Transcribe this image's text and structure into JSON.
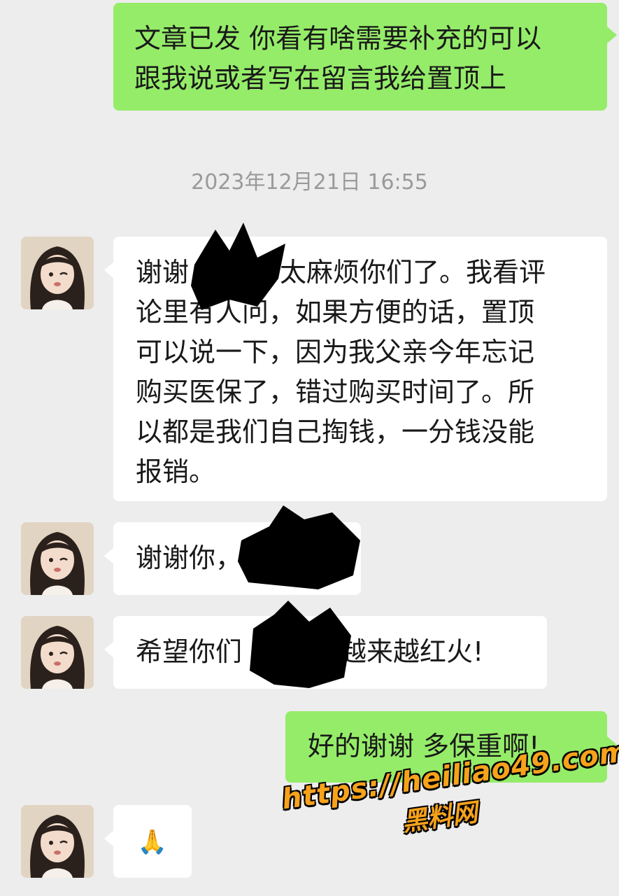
{
  "chat": {
    "messages": [
      {
        "side": "right",
        "lines": [
          "文章已发 你看有啥需要补充的可以",
          "跟我说或者写在留言我给置顶上"
        ]
      },
      {
        "side": "left",
        "lines": [
          "谢谢",
          "太麻烦你们了。我看评",
          "论里有人问，如果方便的话，置顶",
          "可以说一下，因为我父亲今年忘记",
          "购买医保了，错过购买时间了。所",
          "以都是我们自己掏钱，一分钱没能",
          "报销。"
        ]
      },
      {
        "side": "left",
        "text": "谢谢你，"
      },
      {
        "side": "left",
        "text_before": "希望你们",
        "text_after": "越来越红火!"
      },
      {
        "side": "right",
        "text": "好的谢谢 多保重啊!"
      },
      {
        "side": "left",
        "emoji": "🙏"
      }
    ],
    "timestamp": "2023年12月21日 16:55"
  },
  "watermark": {
    "line1": "https://heiliao49.com",
    "line2": "黑料网"
  },
  "colors": {
    "background": "#ededed",
    "sent_bubble": "#95ec69",
    "received_bubble": "#ffffff",
    "timestamp": "#9a9a9a",
    "watermark": "#f7a21b"
  }
}
